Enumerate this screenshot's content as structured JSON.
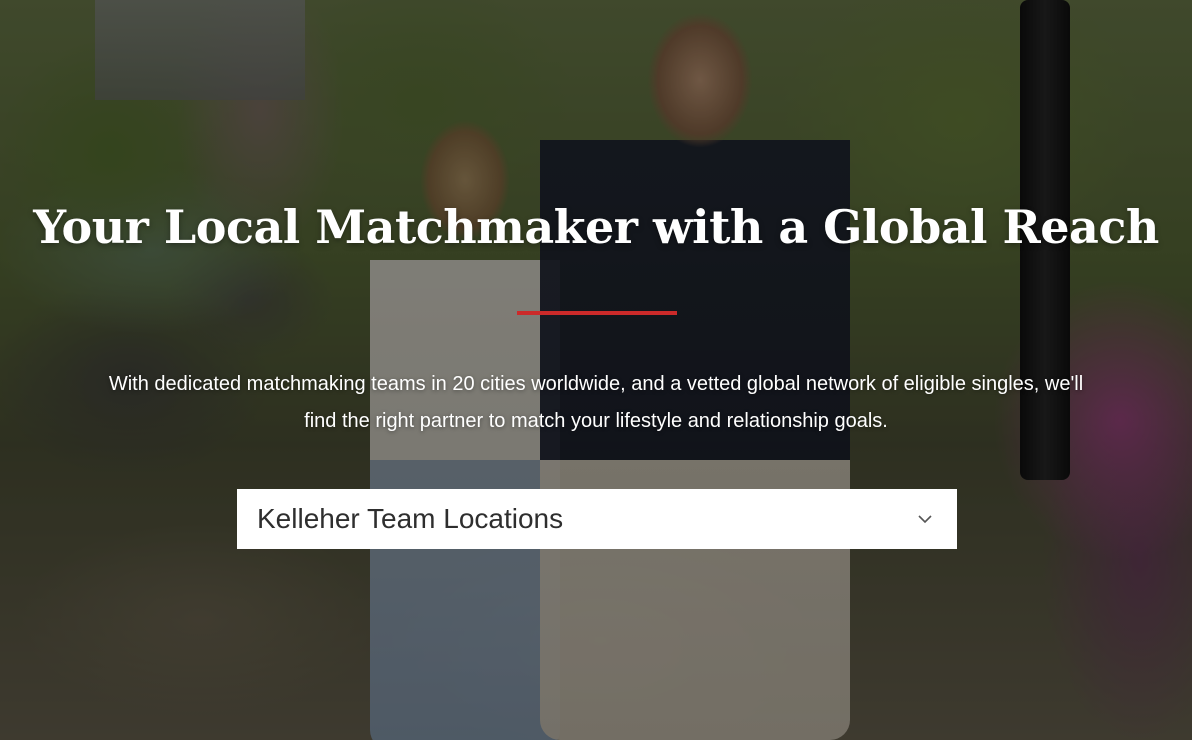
{
  "hero": {
    "headline": "Your Local Matchmaker with a Global Reach",
    "subtext": "With dedicated matchmaking teams in 20 cities worldwide, and a vetted global network of eligible singles, we'll find the right partner to match your lifestyle and relationship goals.",
    "accent_color": "#cc2a2a"
  },
  "locations_select": {
    "selected_value": "Kelleher Team Locations",
    "icon": "chevron-down-icon"
  }
}
